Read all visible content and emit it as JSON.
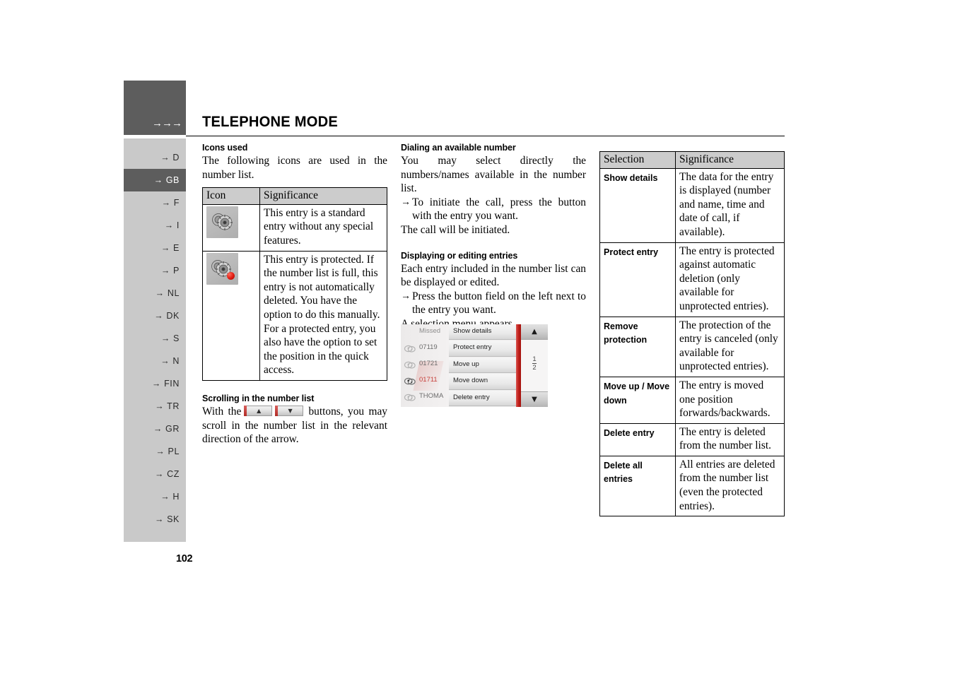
{
  "sidebar": {
    "top_arrows": "→→→",
    "items": [
      {
        "label": "→ D",
        "active": false
      },
      {
        "label": "→ GB",
        "active": true
      },
      {
        "label": "→ F",
        "active": false
      },
      {
        "label": "→ I",
        "active": false
      },
      {
        "label": "→ E",
        "active": false
      },
      {
        "label": "→ P",
        "active": false
      },
      {
        "label": "→ NL",
        "active": false
      },
      {
        "label": "→ DK",
        "active": false
      },
      {
        "label": "→ S",
        "active": false
      },
      {
        "label": "→ N",
        "active": false
      },
      {
        "label": "→ FIN",
        "active": false
      },
      {
        "label": "→ TR",
        "active": false
      },
      {
        "label": "→ GR",
        "active": false
      },
      {
        "label": "→ PL",
        "active": false
      },
      {
        "label": "→ CZ",
        "active": false
      },
      {
        "label": "→ H",
        "active": false
      },
      {
        "label": "→ SK",
        "active": false
      }
    ],
    "active_color": "#5d5d5d",
    "background_color": "#c9c9c9"
  },
  "header": {
    "title": "TELEPHONE MODE"
  },
  "footer": {
    "page_number": "102"
  },
  "col1": {
    "heading": "Icons used",
    "intro": "The following icons are used in the number list.",
    "table": {
      "headers": [
        "Icon",
        "Significance"
      ],
      "rows": [
        {
          "icon": "gear-standard-icon",
          "significance": "This entry is a standard entry without any special features."
        },
        {
          "icon": "gear-protected-icon",
          "significance": "This entry is protected. If the number list is full, this entry is not automatically deleted. You have the option to do this manually. For a protected entry, you also have the option to set the position in the quick access."
        }
      ]
    },
    "scroll_heading": "Scrolling in the number list",
    "scroll_text_before": "With the",
    "scroll_btn_up": "▲",
    "scroll_btn_down": "▼",
    "scroll_text_after": "buttons, you may scroll in the number list in the relevant direction of the arrow."
  },
  "col2": {
    "heading1": "Dialing an available number",
    "para1": "You may select directly the numbers/names available in the number list.",
    "bullet1_arrow": "→",
    "bullet1": "To initiate the call, press the button with the entry you want.",
    "para2": "The call will be initiated.",
    "heading2": "Displaying or editing entries",
    "para3": "Each entry included in the number list can be displayed or edited.",
    "bullet2_arrow": "→",
    "bullet2": "Press the button field on the left next to the entry you want.",
    "para4": "A selection menu appears.",
    "screenshot": {
      "list_header": "Missed",
      "rows": [
        {
          "number": "07119",
          "state": "normal"
        },
        {
          "number": "01721",
          "state": "normal"
        },
        {
          "number": "01711",
          "state": "active"
        },
        {
          "number": "THOMA",
          "state": "normal"
        }
      ],
      "menu_items": [
        "Show details",
        "Protect entry",
        "Move up",
        "Move down",
        "Delete entry"
      ],
      "nav_up": "▲",
      "nav_down": "▼",
      "page_current": "1",
      "page_total": "2",
      "accent_color": "#c0201b"
    }
  },
  "col3": {
    "table": {
      "headers": [
        "Selection",
        "Significance"
      ],
      "rows": [
        {
          "selection": "Show details",
          "significance": "The data for the entry is displayed (number and name, time and date of call, if available)."
        },
        {
          "selection": "Protect entry",
          "significance": "The entry is protected against automatic deletion (only available for unprotected entries)."
        },
        {
          "selection": "Remove protection",
          "significance": "The protection of the entry is canceled (only available for unprotected entries)."
        },
        {
          "selection": "Move up / Move down",
          "significance": "The entry is moved one position forwards/backwards."
        },
        {
          "selection": "Delete entry",
          "significance": "The entry is deleted from the number list."
        },
        {
          "selection": "Delete all entries",
          "significance": "All entries are deleted from the number list (even the protected entries)."
        }
      ]
    }
  }
}
